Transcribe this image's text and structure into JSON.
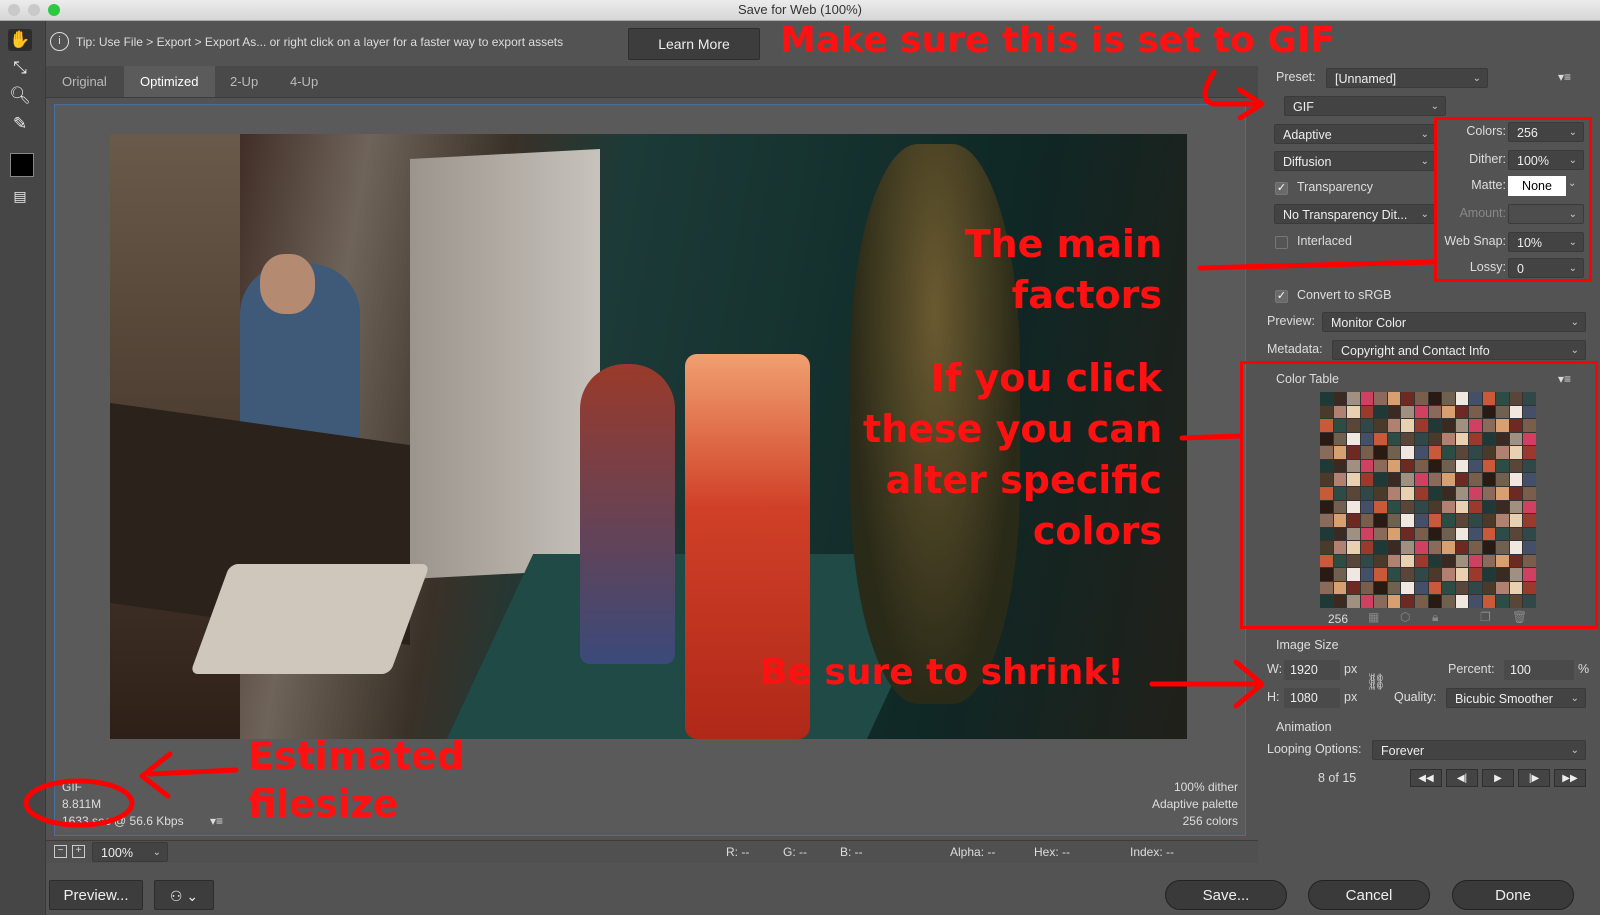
{
  "window": {
    "title": "Save for Web (100%)"
  },
  "tip": {
    "text": "Tip: Use File > Export > Export As...  or right click on a layer for a faster way to export assets",
    "learn_more": "Learn More"
  },
  "tabs": [
    "Original",
    "Optimized",
    "2-Up",
    "4-Up"
  ],
  "annotations": {
    "gif": "Make sure this is set to GIF",
    "factors_1": "The main",
    "factors_2": "factors",
    "click_1": "If you click",
    "click_2": "these you can",
    "click_3": "alter specific",
    "click_4": "colors",
    "shrink": "Be sure to shrink!",
    "filesize_1": "Estimated",
    "filesize_2": "filesize"
  },
  "settings": {
    "preset_label": "Preset:",
    "preset_value": "[Unnamed]",
    "format": "GIF",
    "reduction": "Adaptive",
    "dither_algo": "Diffusion",
    "transparency_label": "Transparency",
    "transparency_dither": "No Transparency Dit...",
    "interlaced_label": "Interlaced",
    "colors_label": "Colors:",
    "colors_value": "256",
    "dither_label": "Dither:",
    "dither_value": "100%",
    "matte_label": "Matte:",
    "matte_value": "None",
    "amount_label": "Amount:",
    "websnap_label": "Web Snap:",
    "websnap_value": "10%",
    "lossy_label": "Lossy:",
    "lossy_value": "0",
    "convert_srgb_label": "Convert to sRGB",
    "preview_label": "Preview:",
    "preview_value": "Monitor Color",
    "metadata_label": "Metadata:",
    "metadata_value": "Copyright and Contact Info"
  },
  "color_table": {
    "title": "Color Table",
    "count": "256"
  },
  "image_size": {
    "title": "Image Size",
    "w_label": "W:",
    "w_value": "1920",
    "h_label": "H:",
    "h_value": "1080",
    "unit": "px",
    "percent_label": "Percent:",
    "percent_value": "100",
    "percent_unit": "%",
    "quality_label": "Quality:",
    "quality_value": "Bicubic Smoother"
  },
  "animation": {
    "title": "Animation",
    "looping_label": "Looping Options:",
    "looping_value": "Forever",
    "frame": "8 of 15"
  },
  "canvas_info": {
    "format": "GIF",
    "size": "8.811M",
    "time": "1633 sec @ 56.6 Kbps",
    "dither": "100% dither",
    "palette": "Adaptive palette",
    "colors": "256 colors"
  },
  "status": {
    "zoom": "100%",
    "r": "R: --",
    "g": "G: --",
    "b": "B: --",
    "alpha": "Alpha: --",
    "hex": "Hex: --",
    "index": "Index: --"
  },
  "buttons": {
    "preview": "Preview...",
    "save": "Save...",
    "cancel": "Cancel",
    "done": "Done"
  },
  "colors": {
    "annotation": "#ff1111",
    "highlight": "#ff0000",
    "canvas_border": "#4a6da0"
  }
}
